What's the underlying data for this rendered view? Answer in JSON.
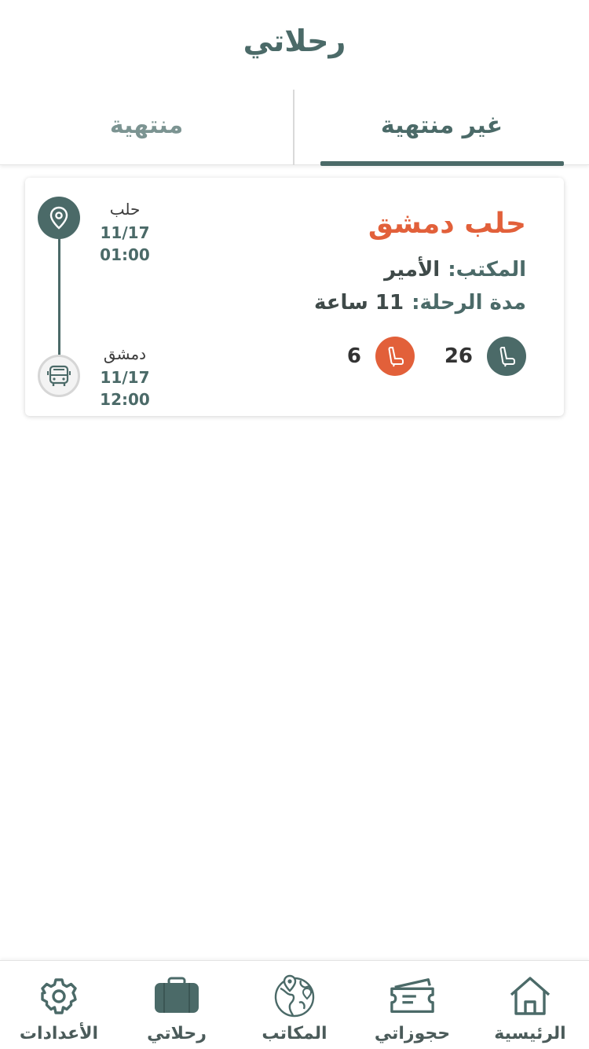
{
  "header": {
    "title": "رحلاتي"
  },
  "tabs": [
    {
      "label": "منتهية",
      "active": false
    },
    {
      "label": "غير منتهية",
      "active": true
    }
  ],
  "trip": {
    "route": "حلب دمشق",
    "office_label": "المكتب:",
    "office_value": "الأمير",
    "duration_label": "مدة الرحلة:",
    "duration_value": "11 ساعة",
    "total_seats": "26",
    "reserved_seats": "6",
    "origin": {
      "city": "حلب",
      "time": "11/17 01:00"
    },
    "destination": {
      "city": "دمشق",
      "time": "11/17 12:00"
    }
  },
  "nav": [
    {
      "label": "الأعدادات",
      "icon": "gear-icon"
    },
    {
      "label": "رحلاتي",
      "icon": "suitcase-icon"
    },
    {
      "label": "المكاتب",
      "icon": "globe-icon"
    },
    {
      "label": "حجوزاتي",
      "icon": "ticket-icon"
    },
    {
      "label": "الرئيسية",
      "icon": "home-icon"
    }
  ],
  "colors": {
    "primary": "#4b6a68",
    "accent": "#e2603a",
    "muted": "#7c9492"
  }
}
